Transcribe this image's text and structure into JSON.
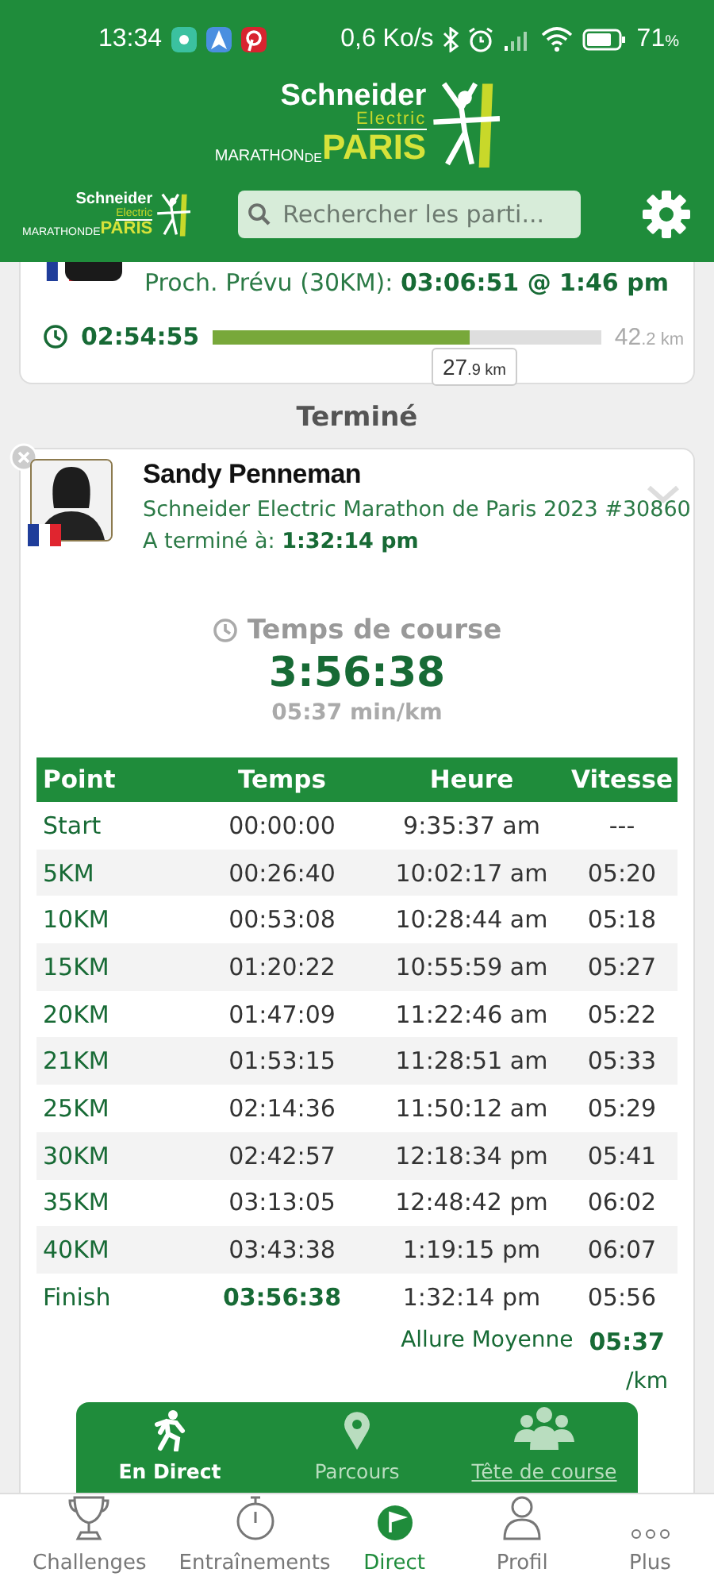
{
  "status_bar": {
    "time": "13:34",
    "speed": "0,6 Ko/s",
    "battery": "71",
    "battery_unit": "%"
  },
  "logo": {
    "brand": "Schneider",
    "sub": "Electric",
    "event": "MARATHON",
    "de": "DE",
    "city": "PARIS"
  },
  "toolbar": {
    "logo": {
      "brand": "Schneider",
      "sub": "Electric",
      "event": "MARATHON",
      "de": "DE",
      "city": "PARIS"
    },
    "search": {
      "placeholder": "Rechercher les parti..."
    }
  },
  "tracked_card": {
    "next_label": "Proch. Prévu (30KM):",
    "next_value": "03:06:51 @ 1:46 pm",
    "elapsed": "02:54:55",
    "level": 0.661,
    "total": "42",
    "total_unit": ".2 km",
    "current": "27",
    "current_unit": ".9 km"
  },
  "section_title": "Terminé",
  "runner": {
    "name": "Sandy Penneman",
    "race": "Schneider Electric Marathon de Paris 2023 #30860",
    "finished_label": "A terminé à:",
    "finished_time": "1:32:14 pm",
    "race_time_label": "Temps de course",
    "race_time": "3:56:38",
    "pace": "05:37 min/km"
  },
  "splits": {
    "columns": [
      "Point",
      "Temps",
      "Heure",
      "Vitesse"
    ],
    "rows": [
      {
        "kind": "split",
        "point": "Start",
        "time": "00:00:00",
        "clock": "9:35:37 am",
        "speed": "---"
      },
      {
        "kind": "split",
        "point": "5KM",
        "time": "00:26:40",
        "clock": "10:02:17 am",
        "speed": "05:20"
      },
      {
        "kind": "split",
        "point": "10KM",
        "time": "00:53:08",
        "clock": "10:28:44 am",
        "speed": "05:18"
      },
      {
        "kind": "split",
        "point": "15KM",
        "time": "01:20:22",
        "clock": "10:55:59 am",
        "speed": "05:27"
      },
      {
        "kind": "split",
        "point": "20KM",
        "time": "01:47:09",
        "clock": "11:22:46 am",
        "speed": "05:22"
      },
      {
        "kind": "split",
        "point": "21KM",
        "time": "01:53:15",
        "clock": "11:28:51 am",
        "speed": "05:33"
      },
      {
        "kind": "split",
        "point": "25KM",
        "time": "02:14:36",
        "clock": "11:50:12 am",
        "speed": "05:29"
      },
      {
        "kind": "split",
        "point": "30KM",
        "time": "02:42:57",
        "clock": "12:18:34 pm",
        "speed": "05:41"
      },
      {
        "kind": "split",
        "point": "35KM",
        "time": "03:13:05",
        "clock": "12:48:42 pm",
        "speed": "06:02"
      },
      {
        "kind": "split",
        "point": "40KM",
        "time": "03:43:38",
        "clock": "1:19:15 pm",
        "speed": "06:07"
      },
      {
        "kind": "finish",
        "point": "Finish",
        "time": "03:56:38",
        "clock": "1:32:14 pm",
        "speed": "05:56"
      }
    ],
    "average_label": "Allure Moyenne",
    "average_value": "05:37",
    "average_unit": "/km"
  },
  "float_nav": [
    {
      "label": "En Direct",
      "selected": true,
      "underlined": false
    },
    {
      "label": "Parcours",
      "selected": false,
      "underlined": false
    },
    {
      "label": "Tête de course",
      "selected": false,
      "underlined": true
    }
  ],
  "bottom_nav": [
    {
      "label": "Challenges",
      "selected": false
    },
    {
      "label": "Entraînements",
      "selected": false
    },
    {
      "label": "Direct",
      "selected": true
    },
    {
      "label": "Profil",
      "selected": false
    },
    {
      "label": "Plus",
      "selected": false
    }
  ]
}
